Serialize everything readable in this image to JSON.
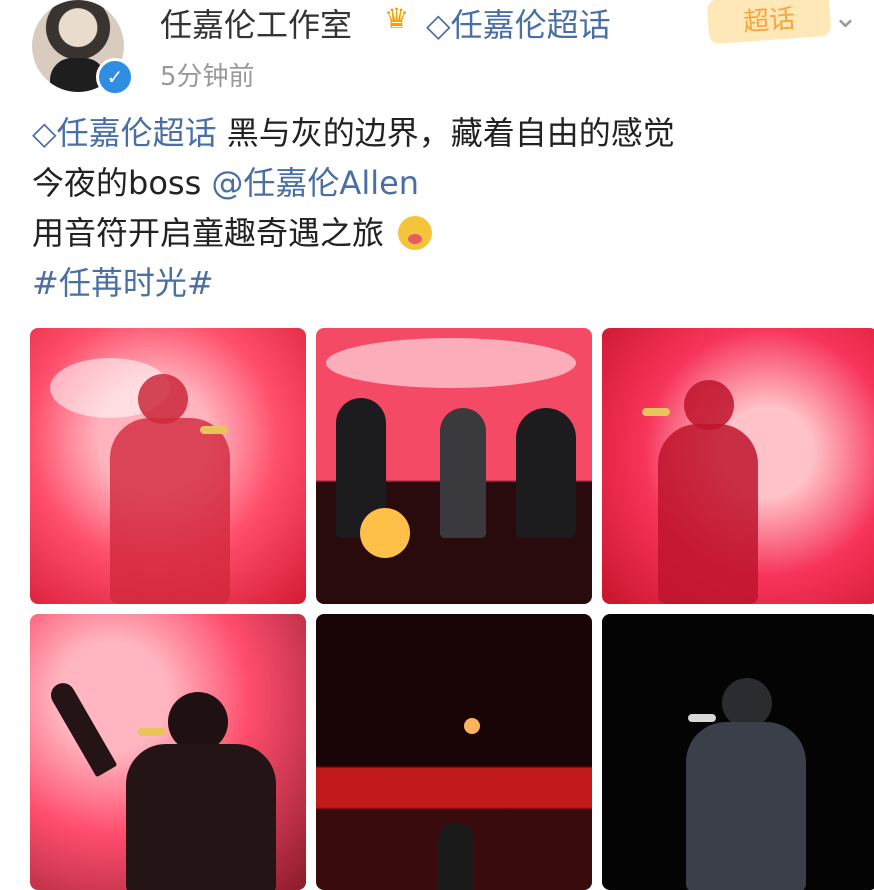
{
  "post": {
    "author": "任嘉伦工作室",
    "crown_icon": "crown-icon",
    "topic_head": "◇任嘉伦超话",
    "time": "5分钟前",
    "badge": "超话",
    "lines": [
      {
        "topic": "◇任嘉伦超话",
        "text": "  黑与灰的边界，藏着自由的感觉"
      },
      {
        "text": "今夜的boss ",
        "mention": "@任嘉伦Allen"
      },
      {
        "text": "用音符开启童趣奇遇之旅"
      },
      {
        "hashtag": "#任苒时光#"
      }
    ]
  },
  "colors": {
    "link": "#4a6fa5",
    "verified": "#2f8de4",
    "badge_bg": "#ffe8b8",
    "badge_text": "#f6a63d"
  }
}
